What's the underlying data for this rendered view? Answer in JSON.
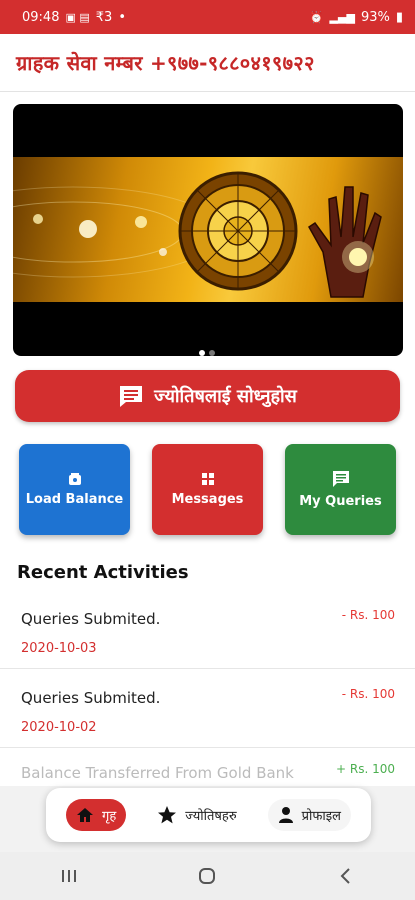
{
  "status_bar": {
    "time": "09:48",
    "indicators": "₹3",
    "battery": "93%"
  },
  "header": {
    "title": "ग्राहक सेवा नम्बर +९७७-९८८०४१९७२२"
  },
  "search_button": {
    "label": "ज्योतिषलाई सोध्नुहोस"
  },
  "tiles": [
    {
      "label": "Load Balance",
      "icon": "wallet-icon",
      "color": "#1e73d2"
    },
    {
      "label": "Messages",
      "icon": "grid-icon",
      "color": "#d32f2f"
    },
    {
      "label": "My Queries",
      "icon": "chat-icon",
      "color": "#2e8b3e"
    }
  ],
  "recent": {
    "title": "Recent Activities",
    "items": [
      {
        "title": "Queries Submited.",
        "date": "2020-10-03",
        "amount": "- Rs. 100"
      },
      {
        "title": "Queries Submited.",
        "date": "2020-10-02",
        "amount": "- Rs. 100"
      },
      {
        "title": "Balance Transferred From Gold Bank",
        "date": "",
        "amount": "+ Rs. 100"
      }
    ]
  },
  "bottom_nav": [
    {
      "label": "गृह",
      "icon": "home-icon",
      "active": true
    },
    {
      "label": "ज्योतिषहरु",
      "icon": "star-icon",
      "active": false
    },
    {
      "label": "प्रोफाइल",
      "icon": "person-icon",
      "active": false
    }
  ],
  "colors": {
    "primary": "#d32f2f",
    "blue": "#1e73d2",
    "green": "#2e8b3e"
  }
}
